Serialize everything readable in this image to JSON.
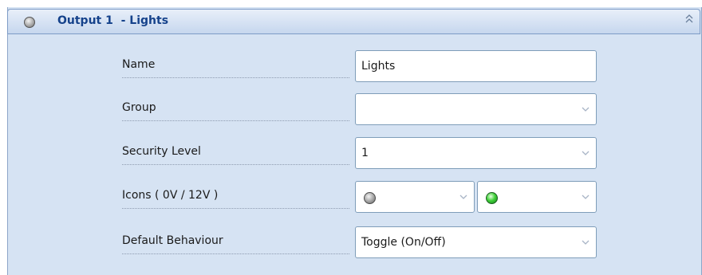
{
  "section": {
    "title": "Output 1  - Lights",
    "icon": "status-dot-grey-icon",
    "collapse_icon": "double-chevron-up-icon"
  },
  "fields": {
    "name": {
      "label": "Name",
      "value": "Lights"
    },
    "group": {
      "label": "Group",
      "value": ""
    },
    "security_level": {
      "label": "Security Level",
      "value": "1"
    },
    "icons": {
      "label": "Icons ( 0V / 12V )",
      "off_icon": "grey-dot-icon",
      "on_icon": "green-dot-icon"
    },
    "default_behaviour": {
      "label": "Default Behaviour",
      "value": "Toggle (On/Off)"
    }
  },
  "colors": {
    "panel_bg": "#d6e3f3",
    "header_text": "#15428b",
    "border": "#7f9db9"
  }
}
